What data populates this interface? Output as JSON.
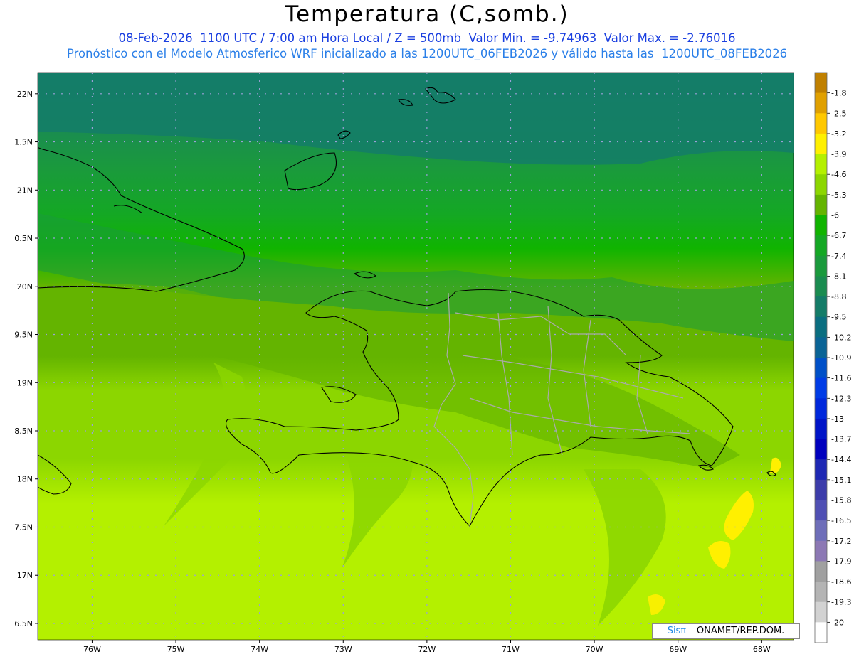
{
  "title": "Temperatura (C,somb.)",
  "subtitle_line1": "08-Feb-2026  1100 UTC / 7:00 am Hora Local / Z = 500mb  Valor Min. = -9.74963  Valor Max. = -2.76016",
  "subtitle_line2": "Pronóstico con el Modelo Atmosferico WRF inicializado a las 1200UTC_06FEB2026 y válido hasta las  1200UTC_08FEB2026",
  "credit": {
    "logo": "Sisπ",
    "text": " – ONAMET/REP.DOM."
  },
  "map": {
    "lon_range": [
      -76.65,
      -67.62
    ],
    "lat_range": [
      16.33,
      22.22
    ],
    "lat_ticks": [
      {
        "value": 22.0,
        "label": "22N"
      },
      {
        "value": 21.5,
        "label": "1.5N"
      },
      {
        "value": 21.0,
        "label": "21N"
      },
      {
        "value": 20.5,
        "label": "0.5N"
      },
      {
        "value": 20.0,
        "label": "20N"
      },
      {
        "value": 19.5,
        "label": "9.5N"
      },
      {
        "value": 19.0,
        "label": "19N"
      },
      {
        "value": 18.5,
        "label": "8.5N"
      },
      {
        "value": 18.0,
        "label": "18N"
      },
      {
        "value": 17.5,
        "label": "7.5N"
      },
      {
        "value": 17.0,
        "label": "17N"
      },
      {
        "value": 16.5,
        "label": "6.5N"
      }
    ],
    "lon_ticks": [
      {
        "value": -76,
        "label": "76W"
      },
      {
        "value": -75,
        "label": "75W"
      },
      {
        "value": -74,
        "label": "74W"
      },
      {
        "value": -73,
        "label": "73W"
      },
      {
        "value": -72,
        "label": "72W"
      },
      {
        "value": -71,
        "label": "71W"
      },
      {
        "value": -70,
        "label": "70W"
      },
      {
        "value": -69,
        "label": "69W"
      },
      {
        "value": -68,
        "label": "68W"
      }
    ]
  },
  "colorbar": [
    {
      "label": "-1.8",
      "color": "#c08000"
    },
    {
      "label": "-2.5",
      "color": "#e0a000"
    },
    {
      "label": "-3.2",
      "color": "#ffc800"
    },
    {
      "label": "-3.9",
      "color": "#fff000"
    },
    {
      "label": "-4.6",
      "color": "#b4f000"
    },
    {
      "label": "-5.3",
      "color": "#8cd600"
    },
    {
      "label": "-6",
      "color": "#64b400"
    },
    {
      "label": "-6.7",
      "color": "#10b400"
    },
    {
      "label": "-7.4",
      "color": "#14a824"
    },
    {
      "label": "-8.1",
      "color": "#1a9a3c"
    },
    {
      "label": "-8.8",
      "color": "#1a8c50"
    },
    {
      "label": "-9.5",
      "color": "#147c68"
    },
    {
      "label": "-10.2",
      "color": "#0a6e80"
    },
    {
      "label": "-10.9",
      "color": "#0a6496"
    },
    {
      "label": "-11.6",
      "color": "#0050c8"
    },
    {
      "label": "-12.3",
      "color": "#003ce6"
    },
    {
      "label": "-13",
      "color": "#0028dc"
    },
    {
      "label": "-13.7",
      "color": "#0014c8"
    },
    {
      "label": "-14.4",
      "color": "#0000be"
    },
    {
      "label": "-15.1",
      "color": "#1e28b4"
    },
    {
      "label": "-15.8",
      "color": "#3c3caa"
    },
    {
      "label": "-16.5",
      "color": "#5050b4"
    },
    {
      "label": "-17.2",
      "color": "#6e6eb9"
    },
    {
      "label": "-17.9",
      "color": "#8c78b4"
    },
    {
      "label": "-18.6",
      "color": "#a0a0a0"
    },
    {
      "label": "-19.3",
      "color": "#b4b4b4"
    },
    {
      "label": "-20",
      "color": "#d2d2d2"
    },
    {
      "label": "",
      "color": "#ffffff"
    }
  ]
}
